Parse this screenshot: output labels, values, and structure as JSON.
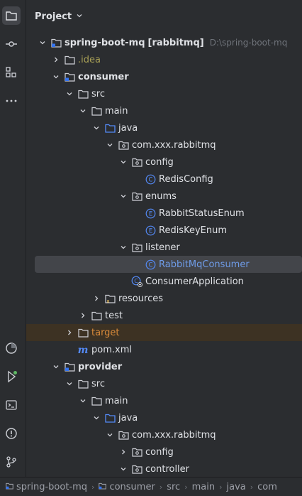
{
  "panel": {
    "title": "Project"
  },
  "tree": [
    {
      "label": "spring-boot-mq",
      "badge": "[rabbitmq]",
      "path": "D:\\spring-boot-mq",
      "icon": "module-icon",
      "depth": 0,
      "chevron": "down"
    },
    {
      "label": ".idea",
      "icon": "folder-icon",
      "depth": 1,
      "chevron": "right",
      "style": "idea"
    },
    {
      "label": "consumer",
      "icon": "module-icon",
      "depth": 1,
      "chevron": "down",
      "style": "bold"
    },
    {
      "label": "src",
      "icon": "folder-icon",
      "depth": 2,
      "chevron": "down"
    },
    {
      "label": "main",
      "icon": "folder-icon",
      "depth": 3,
      "chevron": "down"
    },
    {
      "label": "java",
      "icon": "source-folder-icon",
      "depth": 4,
      "chevron": "down"
    },
    {
      "label": "com.xxx.rabbitmq",
      "icon": "package-icon",
      "depth": 5,
      "chevron": "down"
    },
    {
      "label": "config",
      "icon": "package-icon",
      "depth": 6,
      "chevron": "down"
    },
    {
      "label": "RedisConfig",
      "icon": "class-icon",
      "depth": 7,
      "chevron": "none"
    },
    {
      "label": "enums",
      "icon": "package-icon",
      "depth": 6,
      "chevron": "down"
    },
    {
      "label": "RabbitStatusEnum",
      "icon": "enum-icon",
      "depth": 7,
      "chevron": "none"
    },
    {
      "label": "RedisKeyEnum",
      "icon": "enum-icon",
      "depth": 7,
      "chevron": "none"
    },
    {
      "label": "listener",
      "icon": "package-icon",
      "depth": 6,
      "chevron": "down"
    },
    {
      "label": "RabbitMqConsumer",
      "icon": "class-icon",
      "depth": 7,
      "chevron": "none",
      "style": "selected"
    },
    {
      "label": "ConsumerApplication",
      "icon": "spring-boot-class-icon",
      "depth": 6,
      "chevron": "none"
    },
    {
      "label": "resources",
      "icon": "resources-folder-icon",
      "depth": 4,
      "chevron": "right"
    },
    {
      "label": "test",
      "icon": "folder-icon",
      "depth": 3,
      "chevron": "right"
    },
    {
      "label": "target",
      "icon": "folder-icon",
      "depth": 2,
      "chevron": "right",
      "style": "target"
    },
    {
      "label": "pom.xml",
      "icon": "maven-icon",
      "depth": 2,
      "chevron": "none"
    },
    {
      "label": "provider",
      "icon": "module-icon",
      "depth": 1,
      "chevron": "down",
      "style": "bold"
    },
    {
      "label": "src",
      "icon": "folder-icon",
      "depth": 2,
      "chevron": "down"
    },
    {
      "label": "main",
      "icon": "folder-icon",
      "depth": 3,
      "chevron": "down"
    },
    {
      "label": "java",
      "icon": "source-folder-icon",
      "depth": 4,
      "chevron": "down"
    },
    {
      "label": "com.xxx.rabbitmq",
      "icon": "package-icon",
      "depth": 5,
      "chevron": "down"
    },
    {
      "label": "config",
      "icon": "package-icon",
      "depth": 6,
      "chevron": "right"
    },
    {
      "label": "controller",
      "icon": "package-icon",
      "depth": 6,
      "chevron": "down"
    }
  ],
  "statusbar": {
    "crumbs": [
      {
        "label": "spring-boot-mq",
        "icon": "module-icon"
      },
      {
        "label": "consumer",
        "icon": "module-icon"
      },
      {
        "label": "src",
        "icon": ""
      },
      {
        "label": "main",
        "icon": ""
      },
      {
        "label": "java",
        "icon": ""
      },
      {
        "label": "com",
        "icon": ""
      }
    ]
  },
  "activity_bar": {
    "top": [
      "project-folder-icon",
      "commit-icon",
      "structure-icon",
      "more-icon"
    ],
    "bottom": [
      "services-icon",
      "run-icon",
      "terminal-icon",
      "problems-icon",
      "git-icon"
    ]
  },
  "colors": {
    "background": "#2b2d30",
    "selection": "#43454a",
    "accent_blue": "#3574f0",
    "excluded_bg": "#3d3223"
  }
}
